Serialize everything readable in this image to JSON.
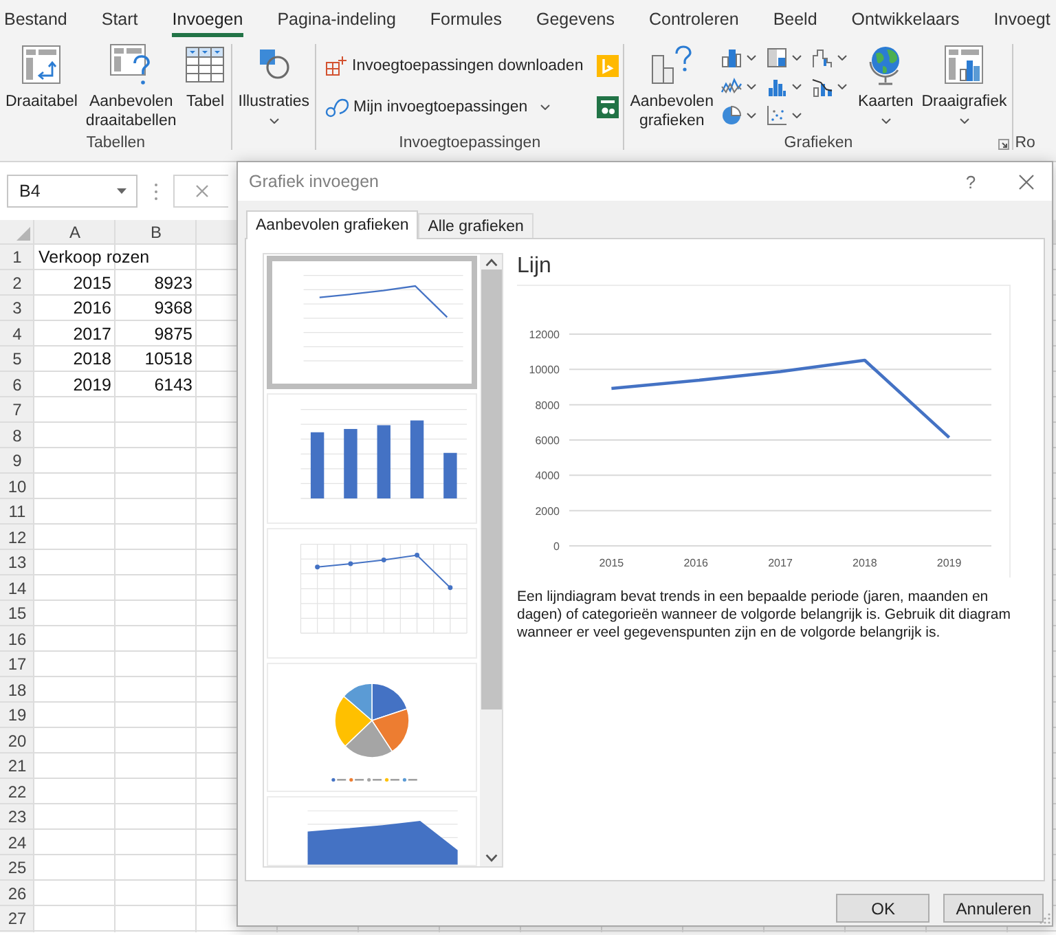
{
  "ribbon": {
    "tabs": [
      {
        "label": "Bestand",
        "selected": false
      },
      {
        "label": "Start",
        "selected": false
      },
      {
        "label": "Invoegen",
        "selected": true
      },
      {
        "label": "Pagina-indeling",
        "selected": false
      },
      {
        "label": "Formules",
        "selected": false
      },
      {
        "label": "Gegevens",
        "selected": false
      },
      {
        "label": "Controleren",
        "selected": false
      },
      {
        "label": "Beeld",
        "selected": false
      },
      {
        "label": "Ontwikkelaars",
        "selected": false
      },
      {
        "label": "Invoegt",
        "selected": false
      }
    ],
    "groups": [
      {
        "kind": "large",
        "label": "Tabellen",
        "buttons": [
          {
            "label": "Draaitabel",
            "dropdown": false
          },
          {
            "label": "Aanbevolen draaitabellen",
            "dropdown": false
          },
          {
            "label": "Tabel",
            "dropdown": false
          }
        ]
      },
      {
        "kind": "large",
        "buttons": [
          {
            "label": "Illustraties",
            "dropdown": true
          }
        ]
      },
      {
        "kind": "rows",
        "label": "Invoegtoepassingen",
        "buttons": [
          {
            "label": "Invoegtoepassingen downloaden",
            "dropdown": false
          },
          {
            "label": "Mijn invoegtoepassingen",
            "dropdown": true
          }
        ]
      },
      {
        "kind": "charts",
        "label": "Grafieken",
        "buttons": [
          {
            "label": "Aanbevolen grafieken",
            "dropdown": false
          },
          {
            "label": "Kaarten",
            "dropdown": true
          },
          {
            "label": "Draaigrafiek",
            "dropdown": true
          }
        ]
      },
      {
        "kind": "cut",
        "label": "Ro"
      }
    ]
  },
  "sheet": {
    "name_box": "B4",
    "columns": [
      "A",
      "B"
    ],
    "rows": [
      {
        "header": "1",
        "cells": [
          {
            "kind": "text",
            "text": "Verkoop rozen"
          }
        ]
      },
      {
        "header": "2",
        "cells": [
          {
            "kind": "number",
            "text": "2015"
          },
          {
            "kind": "number",
            "text": "8923"
          }
        ]
      },
      {
        "header": "3",
        "cells": [
          {
            "kind": "number",
            "text": "2016"
          },
          {
            "kind": "number",
            "text": "9368"
          }
        ]
      },
      {
        "header": "4",
        "cells": [
          {
            "kind": "number",
            "text": "2017"
          },
          {
            "kind": "number",
            "text": "9875"
          }
        ]
      },
      {
        "header": "5",
        "cells": [
          {
            "kind": "number",
            "text": "2018"
          },
          {
            "kind": "number",
            "text": "10518"
          }
        ]
      },
      {
        "header": "6",
        "cells": [
          {
            "kind": "number",
            "text": "2019"
          },
          {
            "kind": "number",
            "text": "6143"
          }
        ]
      },
      {
        "header": "7"
      },
      {
        "header": "8"
      },
      {
        "header": "9"
      },
      {
        "header": "10"
      },
      {
        "header": "11"
      },
      {
        "header": "12"
      },
      {
        "header": "13"
      },
      {
        "header": "14"
      },
      {
        "header": "15"
      },
      {
        "header": "16"
      },
      {
        "header": "17"
      },
      {
        "header": "18"
      },
      {
        "header": "19"
      },
      {
        "header": "20"
      },
      {
        "header": "21"
      },
      {
        "header": "22"
      },
      {
        "header": "23"
      },
      {
        "header": "24"
      },
      {
        "header": "25"
      },
      {
        "header": "26"
      },
      {
        "header": "27"
      }
    ]
  },
  "dialog": {
    "title": "Grafiek invoegen",
    "help": "?",
    "tabs": [
      {
        "label": "Aanbevolen grafieken",
        "selected": true
      },
      {
        "label": "Alle grafieken",
        "selected": false
      }
    ],
    "thumbnails": [
      {
        "kind": "line",
        "selected": true
      },
      {
        "kind": "column",
        "selected": false
      },
      {
        "kind": "scatter",
        "selected": false
      },
      {
        "kind": "pie",
        "selected": false
      },
      {
        "kind": "area",
        "selected": false
      }
    ],
    "preview": {
      "title": "Lijn",
      "chart_data": {
        "type": "line",
        "categories": [
          "2015",
          "2016",
          "2017",
          "2018",
          "2019"
        ],
        "series": [
          {
            "color": "#4472c4",
            "values": [
              8923,
              9368,
              9875,
              10518,
              6143
            ]
          }
        ],
        "ylim": [
          0,
          12000
        ],
        "yticks": [
          0,
          2000,
          4000,
          6000,
          8000,
          10000,
          12000
        ],
        "grid": true
      },
      "description": "Een lijndiagram bevat trends in een bepaalde periode (jaren, maanden en dagen) of categorieën wanneer de volgorde belangrijk is. Gebruik dit diagram wanneer er veel gegevenspunten zijn en de volgorde belangrijk is."
    },
    "buttons": [
      "OK",
      "Annuleren"
    ]
  }
}
